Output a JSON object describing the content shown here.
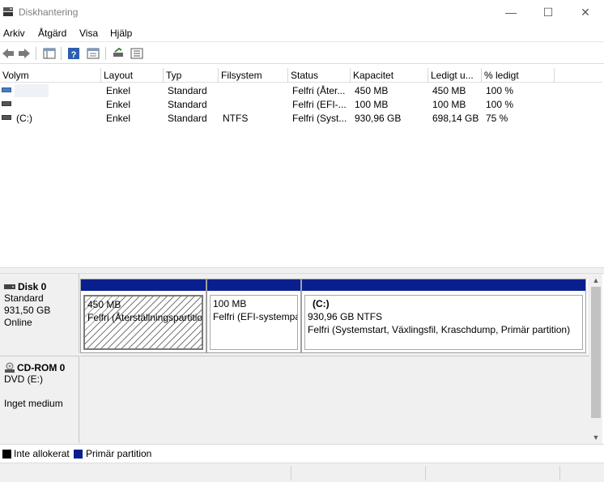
{
  "window": {
    "title": "Diskhantering",
    "minimize": "—",
    "maximize": "☐",
    "close": "✕"
  },
  "menu": [
    "Arkiv",
    "Åtgärd",
    "Visa",
    "Hjälp"
  ],
  "toolbar": [
    "back-arrow-icon",
    "forward-arrow-icon",
    "console-tree-icon",
    "help-icon",
    "properties-icon",
    "connect-disk-icon",
    "settings-list-icon"
  ],
  "volume_table": {
    "columns": [
      "Volym",
      "Layout",
      "Typ",
      "Filsystem",
      "Status",
      "Kapacitet",
      "Ledigt u...",
      "% ledigt"
    ],
    "rows": [
      {
        "volym": "",
        "layout": "Enkel",
        "typ": "Standard",
        "filsystem": "",
        "status": "Felfri (Åter...",
        "kapacitet": "450 MB",
        "ledigt": "450 MB",
        "procent": "100 %"
      },
      {
        "volym": "",
        "layout": "Enkel",
        "typ": "Standard",
        "filsystem": "",
        "status": "Felfri (EFI-...",
        "kapacitet": "100 MB",
        "ledigt": "100 MB",
        "procent": "100 %"
      },
      {
        "volym": "(C:)",
        "layout": "Enkel",
        "typ": "Standard",
        "filsystem": "NTFS",
        "status": "Felfri (Syst...",
        "kapacitet": "930,96 GB",
        "ledigt": "698,14 GB",
        "procent": "75 %"
      }
    ]
  },
  "disks": [
    {
      "name": "Disk 0",
      "type": "Standard",
      "size": "931,50 GB",
      "state": "Online",
      "partitions": [
        {
          "label": "",
          "size": "450 MB",
          "status": "Felfri (Återställningspartition)"
        },
        {
          "label": "",
          "size": "100 MB",
          "status": "Felfri (EFI-systempartition)"
        },
        {
          "label": "(C:)",
          "size": "930,96 GB NTFS",
          "status": "Felfri (Systemstart, Växlingsfil, Kraschdump, Primär partition)"
        }
      ]
    },
    {
      "name": "CD-ROM 0",
      "type": "DVD (E:)",
      "size": "",
      "state": "Inget medium"
    }
  ],
  "legend": [
    {
      "label": "Inte allokerat",
      "color": "#000000"
    },
    {
      "label": "Primär partition",
      "color": "#0a1f8f"
    }
  ],
  "colors": {
    "partition_bar": "#0a1f8f",
    "unallocated": "#000000"
  }
}
